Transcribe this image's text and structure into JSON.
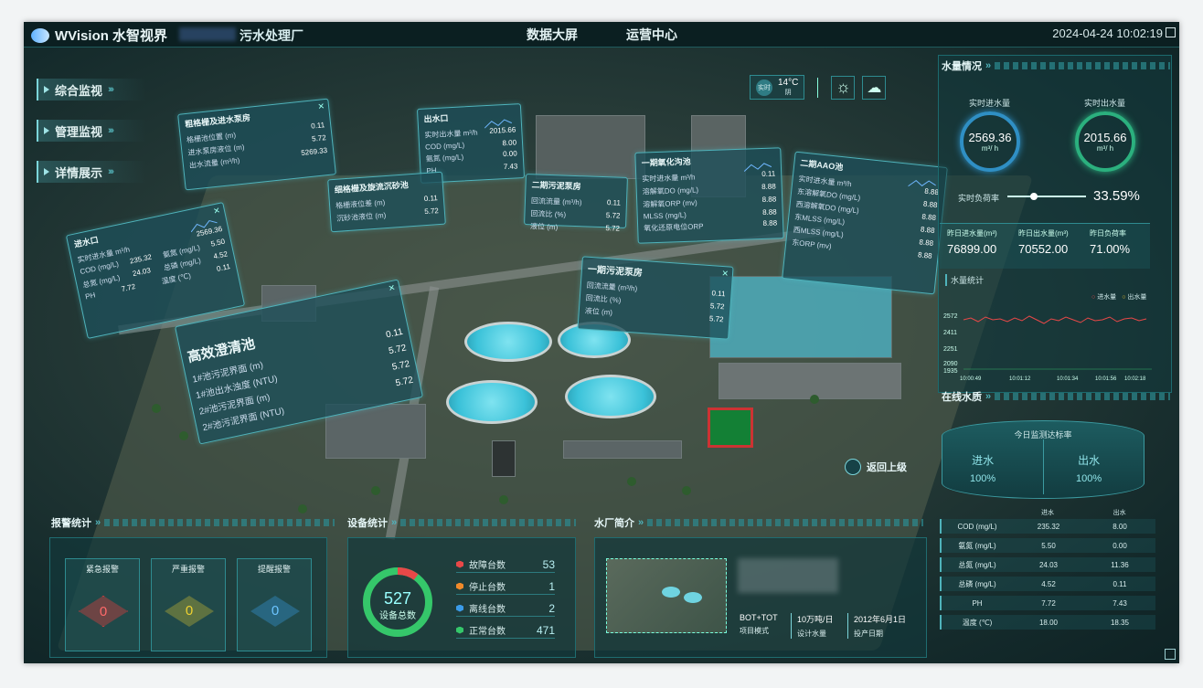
{
  "header": {
    "brand": "WVision 水智视界",
    "plant_name": "污水处理厂",
    "tabs": [
      "数据大屏",
      "运营中心"
    ],
    "datetime": "2024-04-24 10:02:19"
  },
  "nav": [
    "综合监视",
    "管理监视",
    "详情展示"
  ],
  "weather": {
    "mode": "实时",
    "temperature": "14°C",
    "condition": "阴"
  },
  "back_button": "返回上级",
  "panels": {
    "inlet": {
      "title": "进水口",
      "rows": [
        [
          "实时进水量 m³/h",
          "2569.36"
        ],
        [
          "COD (mg/L)",
          "235.32"
        ],
        [
          "氨氮 (mg/L)",
          "5.50"
        ],
        [
          "总氮 (mg/L)",
          "24.03"
        ],
        [
          "总磷 (mg/L)",
          "4.52"
        ],
        [
          "PH",
          "7.72"
        ],
        [
          "温度 (℃)",
          "0.11"
        ]
      ]
    },
    "pump": {
      "title": "粗格栅及进水泵房",
      "rows": [
        [
          "格栅池位置 (m)",
          "0.11"
        ],
        [
          "进水泵房液位 (m)",
          "5.72"
        ],
        [
          "出水流量 (m³/h)",
          "5269.33"
        ]
      ]
    },
    "fine": {
      "title": "细格栅及旋流沉砂池",
      "rows": [
        [
          "格栅液位差 (m)",
          "0.11"
        ],
        [
          "沉砂池液位 (m)",
          "5.72"
        ]
      ]
    },
    "outlet": {
      "title": "出水口",
      "rows": [
        [
          "实时出水量 m³/h",
          "2015.66"
        ],
        [
          "COD (mg/L)",
          "8.00"
        ],
        [
          "氨氮 (mg/L)",
          "0.00"
        ],
        [
          "总磷 (mg/L)",
          "0.11"
        ],
        [
          "PH",
          "7.43"
        ],
        [
          "温度 (℃)",
          "0.11"
        ]
      ]
    },
    "sludge2": {
      "title": "二期污泥泵房",
      "rows": [
        [
          "回流流量 (m³/h)",
          "0.11"
        ],
        [
          "回流比 (%)",
          "5.72"
        ],
        [
          "液位 (m)",
          "5.72"
        ]
      ]
    },
    "oxidation": {
      "title": "一期氧化沟池",
      "rows": [
        [
          "实时进水量 m³/h",
          "0.11"
        ],
        [
          "溶解氧DO (mg/L)",
          "8.88"
        ],
        [
          "溶解氧ORP (mv)",
          "8.88"
        ],
        [
          "MLSS (mg/L)",
          "8.88"
        ],
        [
          "氧化还原电位ORP",
          "8.88"
        ]
      ]
    },
    "aao": {
      "title": "二期AAO池",
      "rows": [
        [
          "实时进水量 m³/h",
          "8.88"
        ],
        [
          "东溶解氧DO (mg/L)",
          "8.88"
        ],
        [
          "西溶解氧DO (mg/L)",
          "8.88"
        ],
        [
          "东MLSS (mg/L)",
          "8.88"
        ],
        [
          "西MLSS (mg/L)",
          "8.88"
        ],
        [
          "东ORP (mv)",
          "8.88"
        ],
        [
          "西ORP (mv)",
          "8.88"
        ]
      ]
    },
    "sludge1": {
      "title": "一期污泥泵房",
      "rows": [
        [
          "回流流量 (m³/h)",
          "0.11"
        ],
        [
          "回流比 (%)",
          "5.72"
        ],
        [
          "液位 (m)",
          "5.72"
        ]
      ]
    },
    "clarifier": {
      "title": "高效澄清池",
      "rows": [
        [
          "1#池污泥界面 (m)",
          "0.11"
        ],
        [
          "1#池出水浊度 (NTU)",
          "5.72"
        ],
        [
          "2#池污泥界面 (m)",
          "5.72"
        ],
        [
          "2#池污泥界面 (NTU)",
          "5.72"
        ]
      ]
    }
  },
  "water": {
    "title": "水量情况",
    "in_label": "实时进水量",
    "in_value": "2569.36",
    "in_unit": "m³/ h",
    "out_label": "实时出水量",
    "out_value": "2015.66",
    "out_unit": "m³/ h",
    "load_label": "实时负荷率",
    "load_value": "33.59%",
    "load_fraction": 0.3359,
    "yesterday": [
      {
        "label": "昨日进水量(m³)",
        "value": "76899.00"
      },
      {
        "label": "昨日出水量(m³)",
        "value": "70552.00"
      },
      {
        "label": "昨日负荷率",
        "value": "71.00%"
      }
    ],
    "stats_title": "水量统计",
    "legend_in": "进水量",
    "legend_out": "出水量",
    "y_ticks": [
      "2572",
      "2411",
      "2251",
      "2090",
      "1935"
    ],
    "x_ticks": [
      "10:00:49",
      "10:01:12",
      "10:01:34",
      "10:01:56",
      "10:02:18"
    ]
  },
  "quality": {
    "title": "在线水质",
    "rate_title": "今日监测达标率",
    "in_label": "进水",
    "in_rate": "100%",
    "out_label": "出水",
    "out_rate": "100%",
    "col_in": "进水",
    "col_out": "出水",
    "rows": [
      {
        "name": "COD (mg/L)",
        "in": "235.32",
        "out": "8.00"
      },
      {
        "name": "氨氮 (mg/L)",
        "in": "5.50",
        "out": "0.00"
      },
      {
        "name": "总氮 (mg/L)",
        "in": "24.03",
        "out": "11.36"
      },
      {
        "name": "总磷 (mg/L)",
        "in": "4.52",
        "out": "0.11"
      },
      {
        "name": "PH",
        "in": "7.72",
        "out": "7.43"
      },
      {
        "name": "温度 (℃)",
        "in": "18.00",
        "out": "18.35"
      }
    ]
  },
  "alarms": {
    "title": "报警统计",
    "cards": [
      {
        "label": "紧急报警",
        "value": "0",
        "color": "#ff3b3b"
      },
      {
        "label": "严重报警",
        "value": "0",
        "color": "#f0d230"
      },
      {
        "label": "提醒报警",
        "value": "0",
        "color": "#3aa8ff"
      }
    ]
  },
  "devices": {
    "title": "设备统计",
    "total": "527",
    "total_label": "设备总数",
    "rows": [
      {
        "label": "故障台数",
        "value": "53",
        "color": "#e84848"
      },
      {
        "label": "停止台数",
        "value": "1",
        "color": "#f08a2a"
      },
      {
        "label": "离线台数",
        "value": "2",
        "color": "#3b9be8"
      },
      {
        "label": "正常台数",
        "value": "471",
        "color": "#35c76a"
      }
    ]
  },
  "intro": {
    "title": "水厂简介",
    "mode_value": "BOT+TOT",
    "mode_label": "项目模式",
    "capacity_value": "10万吨/日",
    "capacity_label": "设计水量",
    "date_value": "2012年6月1日",
    "date_label": "投产日期"
  }
}
